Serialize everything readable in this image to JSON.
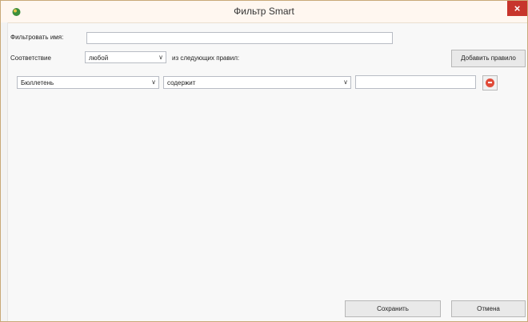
{
  "window": {
    "title": "Фильтр Smart",
    "close": "×"
  },
  "filter_name": {
    "label": "Фильтровать имя:",
    "value": ""
  },
  "match": {
    "label": "Соответствие",
    "selected": "любой",
    "suffix": "из следующих правил:"
  },
  "add_rule_label": "Добавить правило",
  "rules": [
    {
      "field": "Бюллетень",
      "operator": "содержит",
      "value": ""
    }
  ],
  "actions": {
    "save_label": "Сохранить",
    "cancel_label": "Отмена"
  },
  "icons": {
    "app": "app-icon",
    "close": "close-icon",
    "dropdown": "chevron-down-icon",
    "remove": "minus-circle-icon"
  },
  "colors": {
    "close_bg": "#c7352c",
    "remove_icon": "#e04b39",
    "title_bg": "#fff7f0",
    "border": "#c9a978"
  }
}
